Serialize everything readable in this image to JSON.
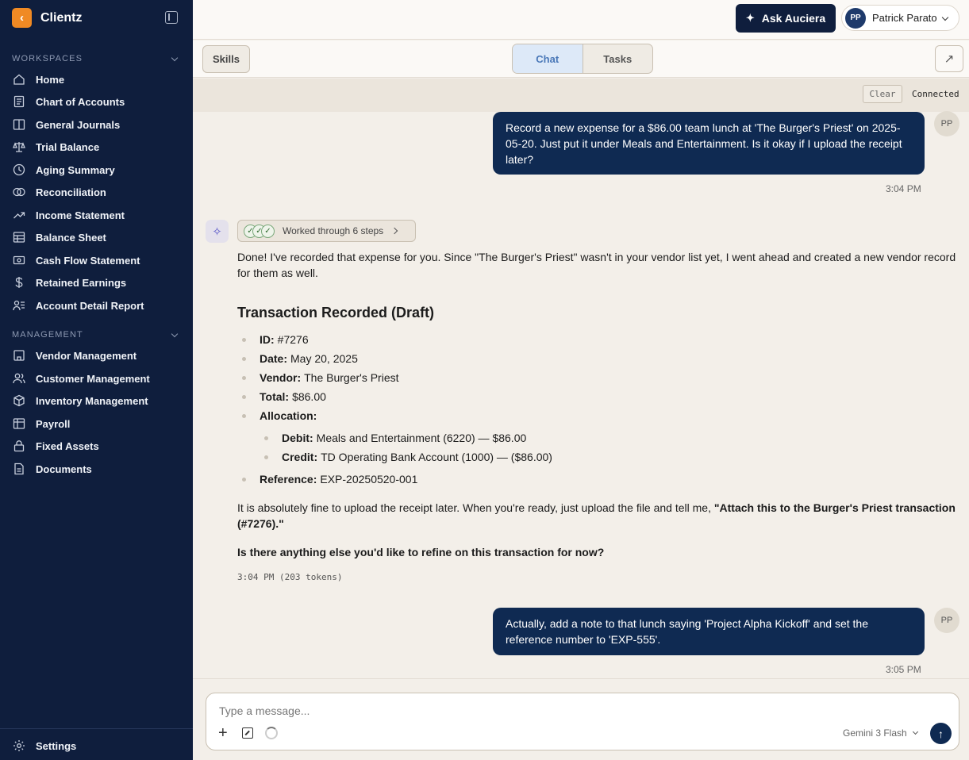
{
  "app": {
    "name": "Clientz",
    "back_glyph": "‹"
  },
  "sidebar": {
    "workspaces_title": "WORKSPACES",
    "workspaces": [
      {
        "label": "Home",
        "icon": "home-icon"
      },
      {
        "label": "Chart of Accounts",
        "icon": "document-icon"
      },
      {
        "label": "General Journals",
        "icon": "book-icon"
      },
      {
        "label": "Trial Balance",
        "icon": "scale-icon"
      },
      {
        "label": "Aging Summary",
        "icon": "clock-icon"
      },
      {
        "label": "Reconciliation",
        "icon": "rings-icon"
      },
      {
        "label": "Income Statement",
        "icon": "trend-icon"
      },
      {
        "label": "Balance Sheet",
        "icon": "table-icon"
      },
      {
        "label": "Cash Flow Statement",
        "icon": "banknote-icon"
      },
      {
        "label": "Retained Earnings",
        "icon": "dollar-icon"
      },
      {
        "label": "Account Detail Report",
        "icon": "user-list-icon"
      }
    ],
    "management_title": "MANAGEMENT",
    "management": [
      {
        "label": "Vendor Management",
        "icon": "store-icon"
      },
      {
        "label": "Customer Management",
        "icon": "users-icon"
      },
      {
        "label": "Inventory Management",
        "icon": "box-icon"
      },
      {
        "label": "Payroll",
        "icon": "grid-icon"
      },
      {
        "label": "Fixed Assets",
        "icon": "lock-icon"
      },
      {
        "label": "Documents",
        "icon": "file-icon"
      }
    ],
    "settings_label": "Settings"
  },
  "topbar": {
    "ask_label": "Ask Auciera",
    "user_initials": "PP",
    "user_name": "Patrick Parato"
  },
  "subbar": {
    "skills_label": "Skills",
    "tabs": [
      {
        "label": "Chat",
        "active": true
      },
      {
        "label": "Tasks",
        "active": false
      }
    ],
    "expand_glyph": "↗"
  },
  "chat_status": {
    "clear_label": "Clear",
    "connection": "Connected"
  },
  "messages": {
    "user1": {
      "text": "Record a new expense for a $86.00 team lunch at 'The Burger's Priest' on 2025-05-20. Just put it under Meals and Entertainment. Is it okay if I upload the receipt later?",
      "time": "3:04 PM",
      "initials": "PP"
    },
    "ai": {
      "steps_label": "Worked through 6 steps",
      "intro": "Done! I've recorded that expense for you. Since \"The Burger's Priest\" wasn't in your vendor list yet, I went ahead and created a new vendor record for them as well.",
      "heading": "Transaction Recorded (Draft)",
      "fields": [
        {
          "key": "ID:",
          "value": "#7276"
        },
        {
          "key": "Date:",
          "value": "May 20, 2025"
        },
        {
          "key": "Vendor:",
          "value": "The Burger's Priest"
        },
        {
          "key": "Total:",
          "value": "$86.00"
        },
        {
          "key": "Allocation:",
          "value": ""
        }
      ],
      "allocation": [
        {
          "key": "Debit:",
          "value": "Meals and Entertainment (6220) — $86.00"
        },
        {
          "key": "Credit:",
          "value": "TD Operating Bank Account (1000) — ($86.00)"
        }
      ],
      "reference": {
        "key": "Reference:",
        "value": "EXP-20250520-001"
      },
      "receipt_text": "It is absolutely fine to upload the receipt later. When you're ready, just upload the file and tell me, ",
      "receipt_quote": "\"Attach this to the Burger's Priest transaction (#7276).\"",
      "question": "Is there anything else you'd like to refine on this transaction for now?",
      "meta": "3:04 PM (203 tokens)"
    },
    "user2": {
      "text": "Actually, add a note to that lunch saying 'Project Alpha Kickoff' and set the reference number to 'EXP-555'.",
      "time": "3:05 PM",
      "initials": "PP"
    }
  },
  "composer": {
    "placeholder": "Type a message...",
    "model": "Gemini 3 Flash"
  },
  "colors": {
    "sidebar_bg": "#0f1e3d",
    "accent_orange": "#f08a24",
    "user_bubble": "#0f2a52",
    "page_bg": "#f3efe9"
  }
}
